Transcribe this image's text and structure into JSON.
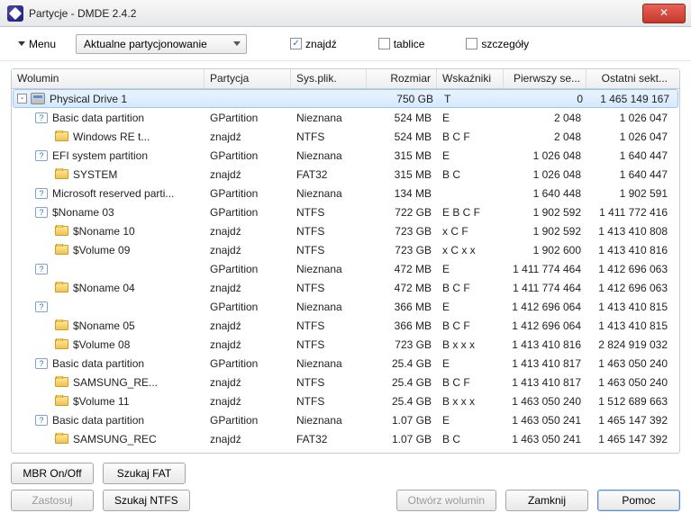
{
  "window": {
    "title": "Partycje - DMDE 2.4.2"
  },
  "toolbar": {
    "menu": "Menu",
    "combo": "Aktualne partycjonowanie",
    "check_find": "znajdź",
    "check_tables": "tablice",
    "check_details": "szczegóły"
  },
  "columns": {
    "volume": "Wolumin",
    "partition": "Partycja",
    "fs": "Sys.plik.",
    "size": "Rozmiar",
    "indicators": "Wskaźniki",
    "first": "Pierwszy se...",
    "last": "Ostatni sekt..."
  },
  "rows": [
    {
      "indent": 0,
      "icon": "drive",
      "expander": "-",
      "name": "Physical Drive 1",
      "partition": "",
      "fs": "",
      "size": "750 GB",
      "ind": "T",
      "first": "0",
      "last": "1 465 149 167",
      "selected": true
    },
    {
      "indent": 1,
      "icon": "q",
      "expander": "",
      "name": "Basic data partition",
      "partition": "GPartition",
      "fs": "Nieznana",
      "size": "524 MB",
      "ind": "E",
      "first": "2 048",
      "last": "1 026 047"
    },
    {
      "indent": 2,
      "icon": "folder",
      "expander": "",
      "name": "Windows RE t...",
      "partition": "znajdź",
      "fs": "NTFS",
      "size": "524 MB",
      "ind": "B C F",
      "first": "2 048",
      "last": "1 026 047"
    },
    {
      "indent": 1,
      "icon": "q",
      "expander": "",
      "name": "EFI system partition",
      "partition": "GPartition",
      "fs": "Nieznana",
      "size": "315 MB",
      "ind": "E",
      "first": "1 026 048",
      "last": "1 640 447"
    },
    {
      "indent": 2,
      "icon": "folder",
      "expander": "",
      "name": "SYSTEM",
      "partition": "znajdź",
      "fs": "FAT32",
      "size": "315 MB",
      "ind": "B C",
      "first": "1 026 048",
      "last": "1 640 447"
    },
    {
      "indent": 1,
      "icon": "q",
      "expander": "",
      "name": "Microsoft reserved parti...",
      "partition": "GPartition",
      "fs": "Nieznana",
      "size": "134 MB",
      "ind": "",
      "first": "1 640 448",
      "last": "1 902 591"
    },
    {
      "indent": 1,
      "icon": "q",
      "expander": "",
      "name": "$Noname 03",
      "partition": "GPartition",
      "fs": "NTFS",
      "size": "722 GB",
      "ind": "E B C F",
      "first": "1 902 592",
      "last": "1 411 772 416"
    },
    {
      "indent": 2,
      "icon": "folder",
      "expander": "",
      "name": "$Noname 10",
      "partition": "znajdź",
      "fs": "NTFS",
      "size": "723 GB",
      "ind": "x C F",
      "first": "1 902 592",
      "last": "1 413 410 808"
    },
    {
      "indent": 2,
      "icon": "folder",
      "expander": "",
      "name": "$Volume 09",
      "partition": "znajdź",
      "fs": "NTFS",
      "size": "723 GB",
      "ind": "x C x x",
      "first": "1 902 600",
      "last": "1 413 410 816"
    },
    {
      "indent": 1,
      "icon": "q",
      "expander": "",
      "name": "",
      "partition": "GPartition",
      "fs": "Nieznana",
      "size": "472 MB",
      "ind": "E",
      "first": "1 411 774 464",
      "last": "1 412 696 063"
    },
    {
      "indent": 2,
      "icon": "folder",
      "expander": "",
      "name": "$Noname 04",
      "partition": "znajdź",
      "fs": "NTFS",
      "size": "472 MB",
      "ind": "B C F",
      "first": "1 411 774 464",
      "last": "1 412 696 063"
    },
    {
      "indent": 1,
      "icon": "q",
      "expander": "",
      "name": "",
      "partition": "GPartition",
      "fs": "Nieznana",
      "size": "366 MB",
      "ind": "E",
      "first": "1 412 696 064",
      "last": "1 413 410 815"
    },
    {
      "indent": 2,
      "icon": "folder",
      "expander": "",
      "name": "$Noname 05",
      "partition": "znajdź",
      "fs": "NTFS",
      "size": "366 MB",
      "ind": "B C F",
      "first": "1 412 696 064",
      "last": "1 413 410 815"
    },
    {
      "indent": 2,
      "icon": "folder",
      "expander": "",
      "name": "$Volume 08",
      "partition": "znajdź",
      "fs": "NTFS",
      "size": "723 GB",
      "ind": "B x x x",
      "first": "1 413 410 816",
      "last": "2 824 919 032"
    },
    {
      "indent": 1,
      "icon": "q",
      "expander": "",
      "name": "Basic data partition",
      "partition": "GPartition",
      "fs": "Nieznana",
      "size": "25.4 GB",
      "ind": "E",
      "first": "1 413 410 817",
      "last": "1 463 050 240"
    },
    {
      "indent": 2,
      "icon": "folder",
      "expander": "",
      "name": "SAMSUNG_RE...",
      "partition": "znajdź",
      "fs": "NTFS",
      "size": "25.4 GB",
      "ind": "B C F",
      "first": "1 413 410 817",
      "last": "1 463 050 240"
    },
    {
      "indent": 2,
      "icon": "folder",
      "expander": "",
      "name": "$Volume 11",
      "partition": "znajdź",
      "fs": "NTFS",
      "size": "25.4 GB",
      "ind": "B x x x",
      "first": "1 463 050 240",
      "last": "1 512 689 663"
    },
    {
      "indent": 1,
      "icon": "q",
      "expander": "",
      "name": "Basic data partition",
      "partition": "GPartition",
      "fs": "Nieznana",
      "size": "1.07 GB",
      "ind": "E",
      "first": "1 463 050 241",
      "last": "1 465 147 392"
    },
    {
      "indent": 2,
      "icon": "folder",
      "expander": "",
      "name": "SAMSUNG_REC",
      "partition": "znajdź",
      "fs": "FAT32",
      "size": "1.07 GB",
      "ind": "B C",
      "first": "1 463 050 241",
      "last": "1 465 147 392"
    }
  ],
  "buttons": {
    "mbr": "MBR On/Off",
    "fat": "Szukaj FAT",
    "apply": "Zastosuj",
    "ntfs": "Szukaj NTFS",
    "open": "Otwórz wolumin",
    "close": "Zamknij",
    "help": "Pomoc"
  }
}
